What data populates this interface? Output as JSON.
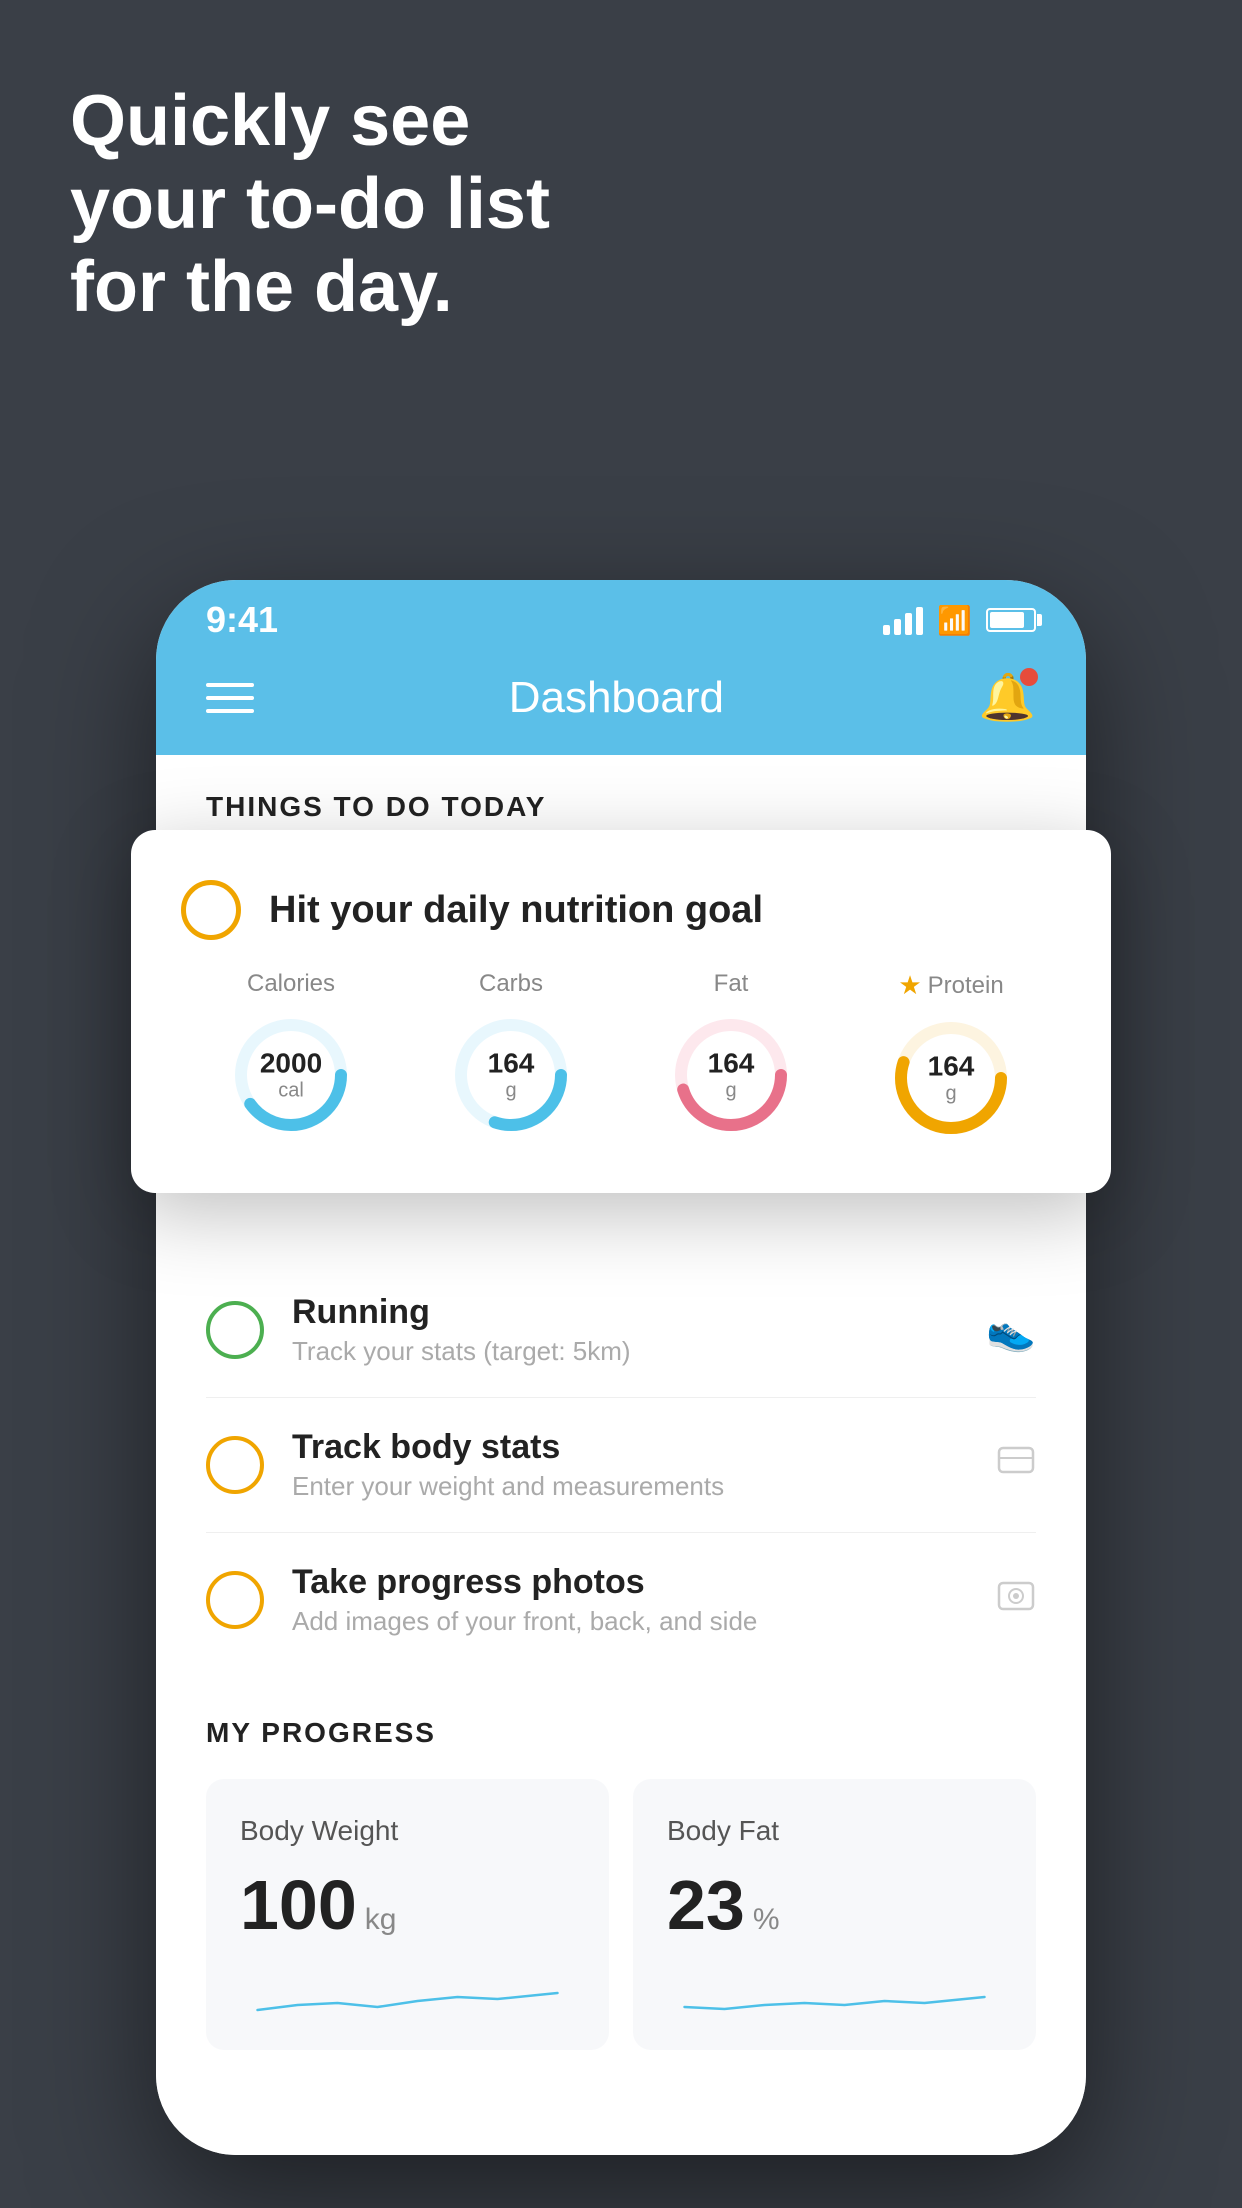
{
  "background": "#3a3f47",
  "hero": {
    "line1": "Quickly see",
    "line2": "your to-do list",
    "line3": "for the day."
  },
  "status_bar": {
    "time": "9:41",
    "signal": "signal",
    "wifi": "wifi",
    "battery": "battery"
  },
  "header": {
    "title": "Dashboard",
    "menu_label": "menu",
    "bell_label": "notifications"
  },
  "section_today": {
    "title": "THINGS TO DO TODAY"
  },
  "floating_card": {
    "todo_label": "Hit your daily nutrition goal",
    "items": [
      {
        "label": "Calories",
        "value": "2000",
        "unit": "cal",
        "color": "#4dc0e8",
        "pct": 65
      },
      {
        "label": "Carbs",
        "value": "164",
        "unit": "g",
        "color": "#4dc0e8",
        "pct": 55
      },
      {
        "label": "Fat",
        "value": "164",
        "unit": "g",
        "color": "#e8718a",
        "pct": 70
      },
      {
        "label": "Protein",
        "value": "164",
        "unit": "g",
        "color": "#f0a500",
        "pct": 80,
        "star": true
      }
    ]
  },
  "todo_items": [
    {
      "title": "Running",
      "subtitle": "Track your stats (target: 5km)",
      "circle_color": "green",
      "icon": "👟"
    },
    {
      "title": "Track body stats",
      "subtitle": "Enter your weight and measurements",
      "circle_color": "yellow",
      "icon": "⊡"
    },
    {
      "title": "Take progress photos",
      "subtitle": "Add images of your front, back, and side",
      "circle_color": "yellow",
      "icon": "👤"
    }
  ],
  "progress": {
    "section_title": "MY PROGRESS",
    "cards": [
      {
        "title": "Body Weight",
        "value": "100",
        "unit": "kg"
      },
      {
        "title": "Body Fat",
        "value": "23",
        "unit": "%"
      }
    ]
  }
}
